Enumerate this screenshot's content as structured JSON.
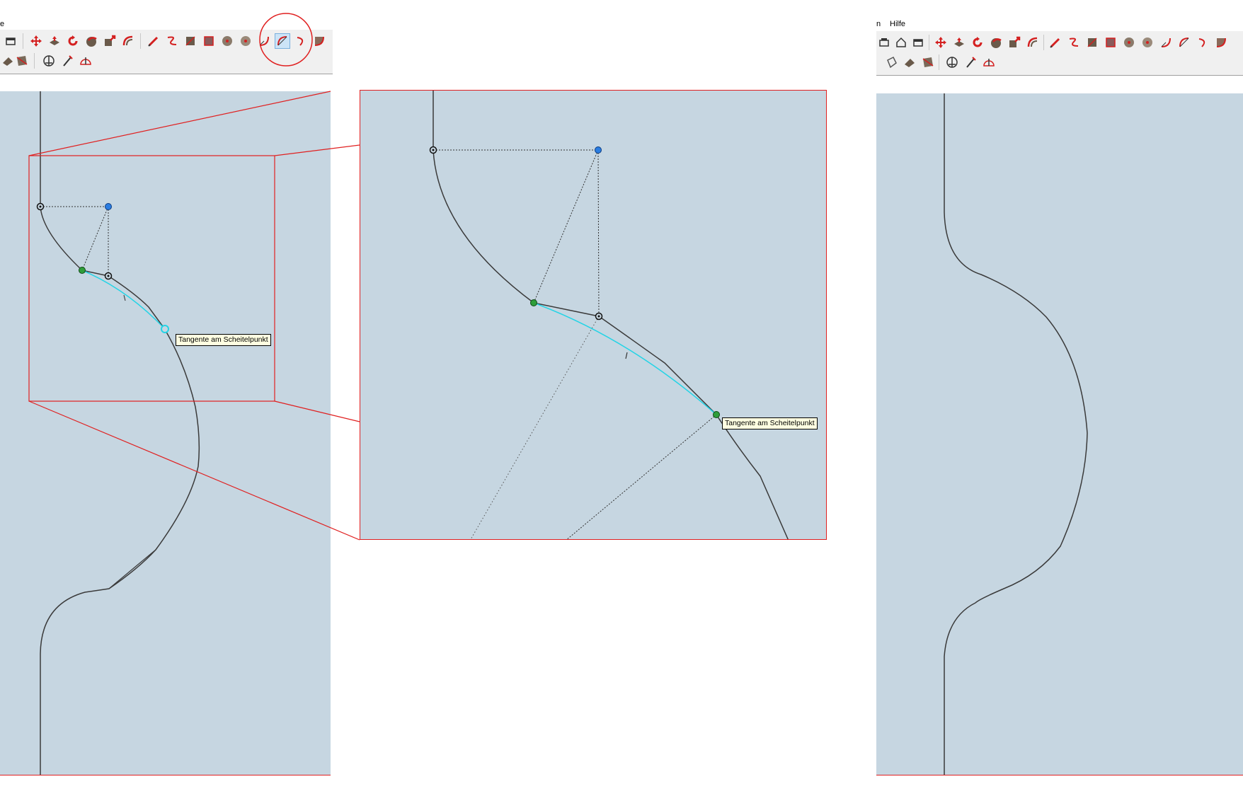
{
  "left_panel": {
    "menu_fragment": "e",
    "tooltip": "Tangente am Scheitelpunkt"
  },
  "zoom_panel": {
    "tooltip": "Tangente am Scheitelpunkt"
  },
  "right_panel": {
    "menu_fragment": "n",
    "menu_help": "Hilfe"
  },
  "toolbar": {
    "row1_icons": [
      "move-icon",
      "pushpull-icon",
      "rotate-icon",
      "followme-icon",
      "scale-icon",
      "offset-icon",
      "pencil-icon",
      "freehand-icon",
      "rectangle-icon",
      "rotated-rectangle-icon",
      "circle-icon",
      "polygon-icon",
      "arc-icon",
      "two-point-arc-icon",
      "three-point-arc-icon",
      "pie-icon"
    ],
    "row2_icons": [
      "paint-icon",
      "eraser-icon",
      "dimension-icon",
      "tape-icon",
      "protractor-icon"
    ],
    "active_tool": "two-point-arc-icon"
  },
  "colors": {
    "viewport": "#c6d6e1",
    "highlight": "#e02020",
    "inference_cyan": "#22d4e6",
    "point_blue": "#2a7de1",
    "point_green": "#2f9e3a",
    "edge": "#3a3a3a"
  }
}
